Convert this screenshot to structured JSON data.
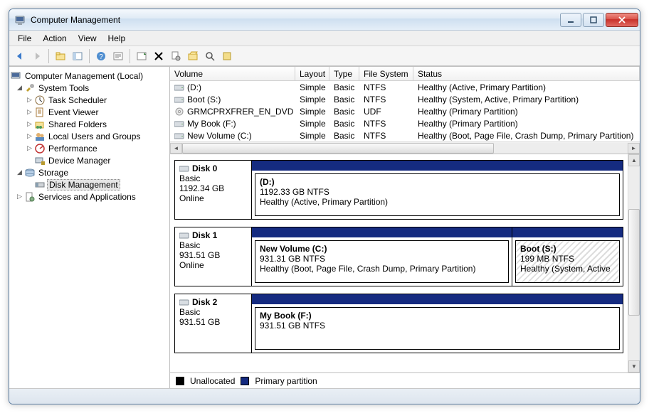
{
  "window": {
    "title": "Computer Management"
  },
  "menu": [
    "File",
    "Action",
    "View",
    "Help"
  ],
  "toolbar_icons": [
    "back",
    "forward",
    "up",
    "props",
    "help",
    "toggle",
    "refresh",
    "delete",
    "settings",
    "folder-open",
    "find",
    "extra"
  ],
  "tree": {
    "root": "Computer Management (Local)",
    "system_tools": "System Tools",
    "task_scheduler": "Task Scheduler",
    "event_viewer": "Event Viewer",
    "shared_folders": "Shared Folders",
    "local_users": "Local Users and Groups",
    "performance": "Performance",
    "device_manager": "Device Manager",
    "storage": "Storage",
    "disk_management": "Disk Management",
    "services_apps": "Services and Applications"
  },
  "list": {
    "headers": {
      "volume": "Volume",
      "layout": "Layout",
      "type": "Type",
      "fs": "File System",
      "status": "Status"
    },
    "rows": [
      {
        "volume": "(D:)",
        "layout": "Simple",
        "type": "Basic",
        "fs": "NTFS",
        "status": "Healthy (Active, Primary Partition)"
      },
      {
        "volume": "Boot (S:)",
        "layout": "Simple",
        "type": "Basic",
        "fs": "NTFS",
        "status": "Healthy (System, Active, Primary Partition)"
      },
      {
        "volume": "GRMCPRXFRER_EN_DVD (E:)",
        "layout": "Simple",
        "type": "Basic",
        "fs": "UDF",
        "status": "Healthy (Primary Partition)"
      },
      {
        "volume": "My Book (F:)",
        "layout": "Simple",
        "type": "Basic",
        "fs": "NTFS",
        "status": "Healthy (Primary Partition)"
      },
      {
        "volume": "New Volume (C:)",
        "layout": "Simple",
        "type": "Basic",
        "fs": "NTFS",
        "status": "Healthy (Boot, Page File, Crash Dump, Primary Partition)"
      }
    ]
  },
  "disks": [
    {
      "name": "Disk 0",
      "type": "Basic",
      "size": "1192.34 GB",
      "state": "Online",
      "parts": [
        {
          "name": "(D:)",
          "size": "1192.33 GB NTFS",
          "status": "Healthy (Active, Primary Partition)"
        }
      ]
    },
    {
      "name": "Disk 1",
      "type": "Basic",
      "size": "931.51 GB",
      "state": "Online",
      "parts": [
        {
          "name": "New Volume  (C:)",
          "size": "931.31 GB NTFS",
          "status": "Healthy (Boot, Page File, Crash Dump, Primary Partition)"
        },
        {
          "name": "Boot  (S:)",
          "size": "199 MB NTFS",
          "status": "Healthy (System, Active",
          "small": true
        }
      ]
    },
    {
      "name": "Disk 2",
      "type": "Basic",
      "size": "931.51 GB",
      "state": "",
      "parts": [
        {
          "name": "My Book  (F:)",
          "size": "931.51 GB NTFS",
          "status": ""
        }
      ]
    }
  ],
  "legend": {
    "unallocated": "Unallocated",
    "primary": "Primary partition"
  }
}
